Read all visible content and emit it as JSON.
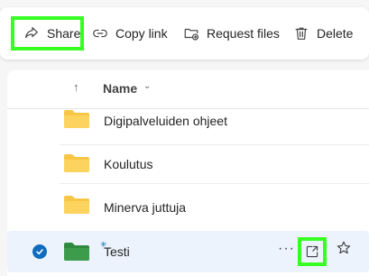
{
  "toolbar": {
    "share_label": "Share",
    "copy_link_label": "Copy link",
    "request_files_label": "Request files",
    "delete_label": "Delete"
  },
  "list": {
    "header": {
      "name_label": "Name",
      "sort_icon": "↑",
      "chevron": "⌄"
    },
    "rows": [
      {
        "name": "Digipalveluiden ohjeet",
        "folder_color": "#f8c646",
        "selected": false
      },
      {
        "name": "Koulutus",
        "folder_color": "#f8c646",
        "selected": false
      },
      {
        "name": "Minerva juttuja",
        "folder_color": "#f8c646",
        "selected": false
      },
      {
        "name": "Testi",
        "folder_color": "#2f8a3f",
        "selected": true,
        "new_indicator": true
      }
    ],
    "row_actions": {
      "more_label": "···"
    }
  },
  "colors": {
    "accent": "#0f6cbd",
    "highlight_box": "#37ff24",
    "selected_row_bg": "#edf3fc"
  },
  "icons": {
    "share": "share-icon",
    "copy_link": "link-icon",
    "request_files": "folder-request-icon",
    "delete": "trash-icon",
    "sort": "arrow-up-icon",
    "folder": "folder-icon",
    "check": "checkmark-icon",
    "more": "more-horizontal-icon",
    "favorite": "star-icon"
  }
}
